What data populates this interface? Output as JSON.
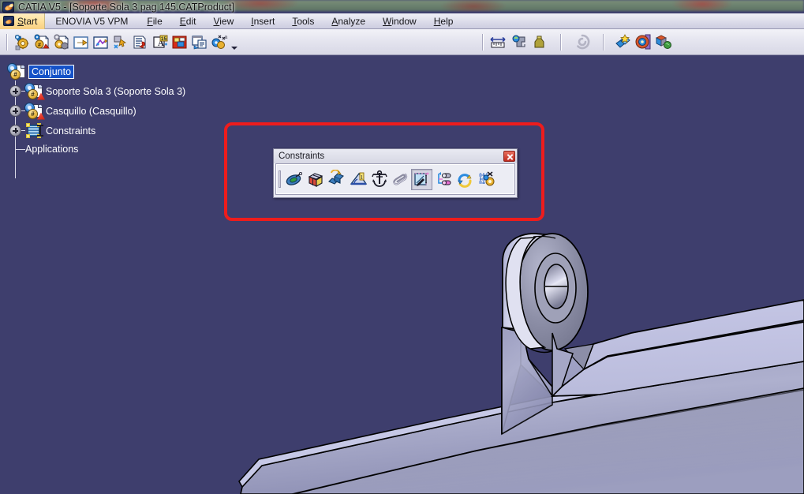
{
  "window": {
    "title": "CATIA V5 - [Soporte Sola 3 pag 145.CATProduct]",
    "app_icon": "catia-icon"
  },
  "menubar": {
    "start_label": "Start",
    "start_icon": "catia-icon",
    "items": [
      {
        "label": "ENOVIA V5 VPM",
        "accel": "",
        "name": "menu-enovia"
      },
      {
        "label": "File",
        "accel": "F",
        "name": "menu-file"
      },
      {
        "label": "Edit",
        "accel": "E",
        "name": "menu-edit"
      },
      {
        "label": "View",
        "accel": "V",
        "name": "menu-view"
      },
      {
        "label": "Insert",
        "accel": "I",
        "name": "menu-insert"
      },
      {
        "label": "Tools",
        "accel": "T",
        "name": "menu-tools"
      },
      {
        "label": "Analyze",
        "accel": "A",
        "name": "menu-analyze"
      },
      {
        "label": "Window",
        "accel": "W",
        "name": "menu-window"
      },
      {
        "label": "Help",
        "accel": "H",
        "name": "menu-help"
      }
    ]
  },
  "toolbar": {
    "buttons": [
      {
        "name": "new-product-icon",
        "tip": "New Product"
      },
      {
        "name": "existing-component-icon",
        "tip": "Existing Component"
      },
      {
        "name": "replace-component-icon",
        "tip": "Replace Component"
      },
      {
        "name": "graph-tree-reordering-icon",
        "tip": "Graph Tree Reordering"
      },
      {
        "name": "generate-numbering-icon",
        "tip": "Generate Numbering"
      },
      {
        "name": "selective-load-icon",
        "tip": "Selective Load"
      },
      {
        "name": "manage-representations-icon",
        "tip": "Manage Representations"
      },
      {
        "name": "fast-multi-instantiation-icon",
        "tip": "Fast Multi Instantiation"
      },
      {
        "name": "define-multi-instantiation-icon",
        "tip": "Define Multi Instantiation"
      },
      {
        "name": "scene-icon",
        "tip": "Scene Browser"
      },
      {
        "name": "toolbar-overflow-caret",
        "tip": "More"
      },
      {
        "name": "measure-between-icon",
        "tip": "Measure Between"
      },
      {
        "name": "measure-item-icon",
        "tip": "Measure Item"
      },
      {
        "name": "measure-inertia-icon",
        "tip": "Measure Inertia"
      },
      {
        "name": "update-all-icon",
        "tip": "Update All"
      },
      {
        "name": "catalog-browser-icon",
        "tip": "Catalog Browser"
      },
      {
        "name": "scene-browser-icon",
        "tip": "Scene Browser"
      },
      {
        "name": "apply-material-icon",
        "tip": "Apply Material"
      }
    ]
  },
  "tree": {
    "root": {
      "label": "Conjunto",
      "selected": true,
      "icon": "product-icon"
    },
    "children": [
      {
        "label": "Soporte Sola 3 (Soporte Sola 3)",
        "icon": "part-icon",
        "expandable": true
      },
      {
        "label": "Casquillo (Casquillo)",
        "icon": "part-icon",
        "expandable": true
      },
      {
        "label": "Constraints",
        "icon": "constraints-icon",
        "expandable": true
      }
    ],
    "leaf": {
      "label": "Applications"
    }
  },
  "constraints_dialog": {
    "title": "Constraints",
    "close_label": "Close",
    "buttons": [
      {
        "name": "coincidence-constraint-icon",
        "tip": "Coincidence Constraint"
      },
      {
        "name": "contact-constraint-icon",
        "tip": "Contact Constraint"
      },
      {
        "name": "offset-constraint-icon",
        "tip": "Offset Constraint"
      },
      {
        "name": "angle-constraint-icon",
        "tip": "Angle Constraint"
      },
      {
        "name": "fix-component-icon",
        "tip": "Fix Component"
      },
      {
        "name": "fix-together-icon",
        "tip": "Fix Together"
      },
      {
        "name": "quick-constraint-icon",
        "tip": "Quick Constraint",
        "pressed": true
      },
      {
        "name": "change-constraint-icon",
        "tip": "Change Constraint"
      },
      {
        "name": "reuse-pattern-icon",
        "tip": "Reuse Pattern"
      },
      {
        "name": "flexible-rigid-subassembly-icon",
        "tip": "Flexible/Rigid Sub-Assembly"
      }
    ]
  },
  "annotation": {
    "highlight_color": "#ee1c1c",
    "shape": "rounded-rectangle"
  },
  "viewport": {
    "background_color": "#3e3e6d",
    "model_name": "Soporte Sola 3 assembly",
    "part_color": "#b9bbdd",
    "edge_color": "#000000"
  }
}
